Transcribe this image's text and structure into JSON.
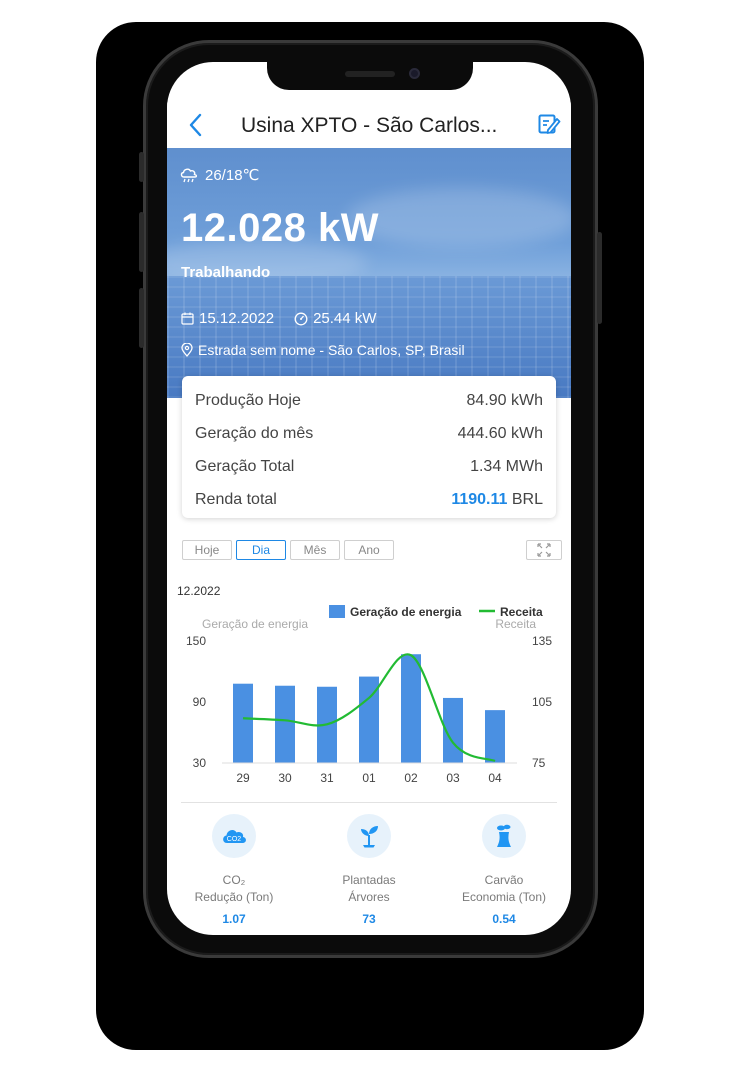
{
  "header": {
    "title": "Usina XPTO - São Carlos..."
  },
  "hero": {
    "weather": "26/18℃",
    "power": "12.028 kW",
    "status": "Trabalhando",
    "date": "15.12.2022",
    "capacity": "25.44 kW",
    "address": "Estrada sem nome - São Carlos, SP, Brasil"
  },
  "stats": [
    {
      "label": "Produção Hoje",
      "value": "84.90 kWh"
    },
    {
      "label": "Geração do mês",
      "value": "444.60 kWh"
    },
    {
      "label": "Geração Total",
      "value": "1.34 MWh"
    }
  ],
  "income": {
    "label": "Renda total",
    "amount": "1190.11",
    "currency": "BRL"
  },
  "tabs": [
    {
      "label": "Hoje",
      "active": false
    },
    {
      "label": "Dia",
      "active": true
    },
    {
      "label": "Mês",
      "active": false
    },
    {
      "label": "Ano",
      "active": false
    }
  ],
  "chart_data": {
    "type": "bar",
    "period": "12.2022",
    "categories": [
      "29",
      "30",
      "31",
      "01",
      "02",
      "03",
      "04"
    ],
    "series": [
      {
        "name": "Geração de energia",
        "kind": "bar",
        "axis": "left",
        "color": "#4a90e2",
        "values": [
          108,
          106,
          105,
          115,
          137,
          94,
          82
        ]
      },
      {
        "name": "Receita",
        "kind": "line",
        "axis": "right",
        "color": "#22bb33",
        "values": [
          97,
          96,
          94,
          107,
          128,
          85,
          76
        ]
      }
    ],
    "ylabel_left": "Geração de energia",
    "ylabel_right": "Receita",
    "ylim_left": [
      30,
      150
    ],
    "ylim_right": [
      75,
      135
    ],
    "yticks_left": [
      "150",
      "90",
      "30"
    ],
    "yticks_right": [
      "135",
      "105",
      "75"
    ],
    "legend": "top-right"
  },
  "eco": [
    {
      "icon": "co2-cloud-icon",
      "label_line1": "CO₂",
      "label_line2": "Redução (Ton)",
      "value": "1.07"
    },
    {
      "icon": "sprout-icon",
      "label_line1": "Plantadas",
      "label_line2": "Árvores",
      "value": "73"
    },
    {
      "icon": "power-plant-icon",
      "label_line1": "Carvão",
      "label_line2": "Economia (Ton)",
      "value": "0.54"
    }
  ],
  "colors": {
    "accent": "#1e88e5",
    "bar": "#4a90e2",
    "line": "#22bb33"
  }
}
